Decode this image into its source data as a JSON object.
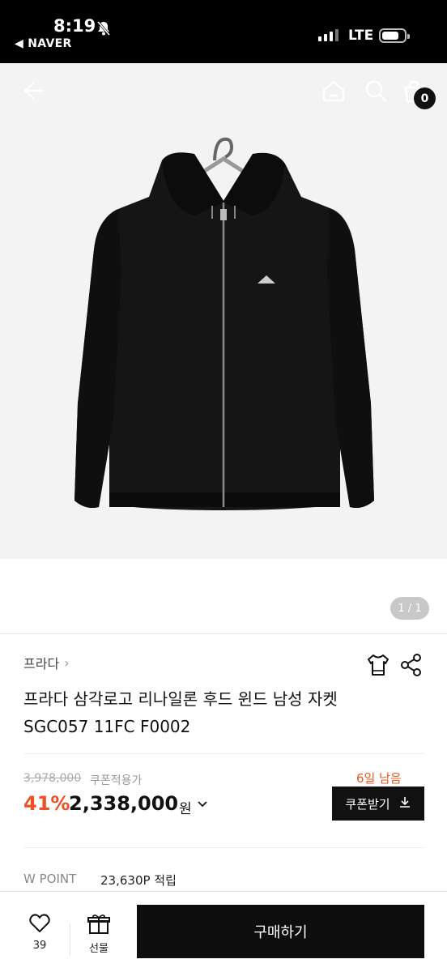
{
  "status_bar": {
    "time": "8:19",
    "back_app": "◀ NAVER",
    "network": "LTE",
    "icons": [
      "bell-off-icon",
      "signal-icon",
      "battery-icon"
    ]
  },
  "header": {
    "icons": [
      "back-arrow-icon",
      "home-icon",
      "search-icon",
      "cart-icon"
    ],
    "cart_count": "0"
  },
  "gallery": {
    "page_indicator": "1 / 1"
  },
  "product": {
    "brand": "프라다",
    "brand_chevron": "›",
    "title_line1": "프라다 삼각로고 리나일론 후드 윈드 남성 자켓",
    "title_line2": "SGC057 11FC F0002",
    "actions": [
      "size-guide-shirt-icon",
      "share-icon"
    ]
  },
  "pricing": {
    "original_price": "3,978,000",
    "coupon_note": "쿠폰적용가",
    "days_left": "6일 남음",
    "discount": "41%",
    "price": "2,338,000",
    "currency": "원",
    "coupon_button_label": "쿠폰받기",
    "accent_color": "#f04e23"
  },
  "points": {
    "label": "W POINT",
    "value": "23,630P 적립"
  },
  "bottom_bar": {
    "like_count": "39",
    "gift_label": "선물",
    "buy_label": "구매하기"
  }
}
